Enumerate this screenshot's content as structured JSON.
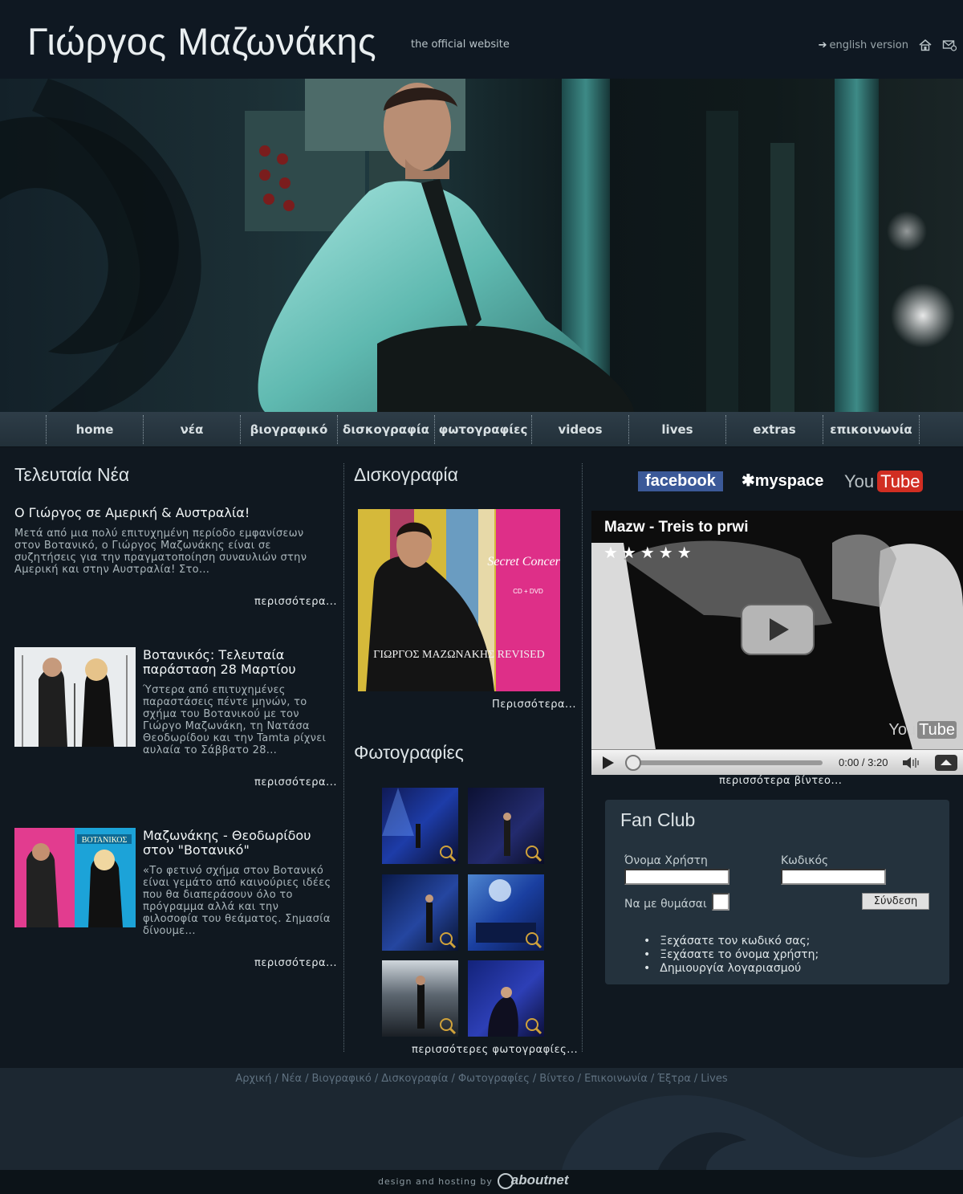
{
  "header": {
    "title": "Γιώργος Μαζωνάκης",
    "subtitle": "the official website",
    "english_version": "english version",
    "home_icon": "home-icon",
    "mail_icon": "mail-icon"
  },
  "nav": {
    "items": [
      "home",
      "νέα",
      "βιογραφικό",
      "δισκογραφία",
      "φωτογραφίες",
      "videos",
      "lives",
      "extras",
      "επικοινωνία"
    ]
  },
  "news": {
    "section_title": "Τελευταία Νέα",
    "items": [
      {
        "title": "Ο Γιώργος σε Αμερική & Αυστραλία!",
        "lines": [
          "Μετά από μια πολύ επιτυχημένη περίοδο εμφανίσεων",
          "στον  Βοτανικό, ο Γιώργος Μαζωνάκης είναι σε",
          "συζητήσεις για την πραγματοποίηση συναυλιών στην",
          "Αμερική και στην Αυστραλία! Στο..."
        ],
        "more": "περισσότερα..."
      },
      {
        "title_lines": [
          "Βοτανικός: Τελευταία",
          "παράσταση 28 Μαρτίου"
        ],
        "lines": [
          "Ύστερα από  επιτυχημένες",
          "παραστάσεις πέντε μηνών, το",
          "σχήμα του Βοτανικού με τον",
          "Γιώργο Μαζωνάκη, τη Νατάσα",
          "Θεοδωρίδου και την Tamta ρίχνει",
          "αυλαία το Σάββατο 28..."
        ],
        "more": "περισσότερα..."
      },
      {
        "title_lines": [
          "Μαζωνάκης - Θεοδωρίδου",
          "στον \"Βοτανικό\""
        ],
        "lines": [
          "«Το φετινό σχήμα στον Βοτανικό",
          "είναι γεμάτο από καινούριες ιδέες",
          "που θα διαπεράσουν όλο το",
          "πρόγραμμα αλλά και την",
          "φιλοσοφία του θεάματος. Σημασία",
          "δίνουμε..."
        ],
        "more": "περισσότερα...",
        "poster_text": "ΒΟΤΑΝΙΚΟΣ"
      }
    ]
  },
  "discography": {
    "section_title": "Δισκογραφία",
    "album_caption": "ΓΙΩΡΓΟΣ ΜΑΖΩΝΑΚΗΣ  REVISED",
    "album_badge": "Secret Concerts",
    "album_format": "CD + DVD",
    "more": "Περισσότερα..."
  },
  "photos": {
    "section_title": "Φωτογραφίες",
    "count": 6,
    "zoom_icon": "magnifier-icon",
    "more": "περισσότερες φωτογραφίες..."
  },
  "social": {
    "facebook": "facebook",
    "myspace": "myspace",
    "youtube_you": "You",
    "youtube_tube": "Tube"
  },
  "video": {
    "title": "Mazw - Treis to prwi",
    "stars": "★★★★★",
    "rating": 5,
    "time": "0:00 / 3:20",
    "watermark_you": "You",
    "watermark_tube": "Tube",
    "more": "περισσότερα βίντεο..."
  },
  "fanclub": {
    "title": "Fan Club",
    "username_label": "Όνομα Χρήστη",
    "password_label": "Κωδικός",
    "remember_label": "Να με θυμάσαι",
    "login_button": "Σύνδεση",
    "links": [
      "Ξεχάσατε τον κωδικό σας;",
      "Ξεχάσατε το όνομα χρήστη;",
      "Δημιουργία λογαριασμού"
    ]
  },
  "footer": {
    "links": [
      "Αρχική",
      "Νέα",
      "Βιογραφικό",
      "Δισκογραφία",
      "Φωτογραφίες",
      "Βίντεο",
      "Επικοινωνία",
      "Έξτρα",
      "Lives"
    ],
    "separator": "/",
    "credit": "design and hosting by",
    "credit_logo": "aboutnet"
  },
  "colors": {
    "background": "#101820",
    "accent_facebook": "#3b5998",
    "accent_youtube": "#d12e22",
    "fanclub_panel": "#24323d"
  }
}
